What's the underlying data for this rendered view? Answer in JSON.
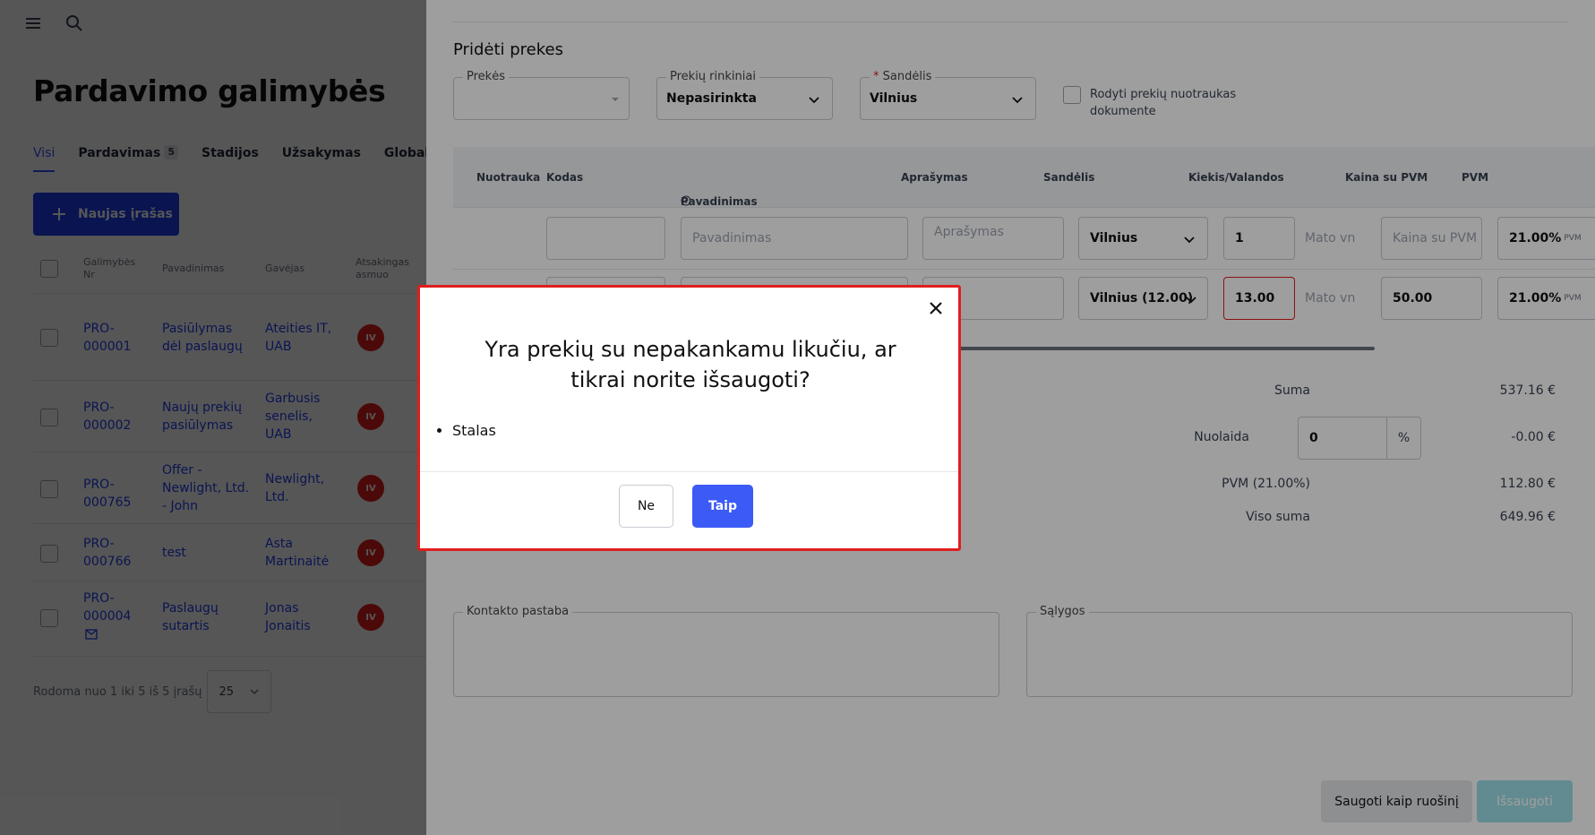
{
  "left": {
    "title": "Pardavimo galimybės",
    "tabs": [
      {
        "label": "Visi",
        "count": ""
      },
      {
        "label": "Pardavimas",
        "count": "5"
      },
      {
        "label": "Stadijos",
        "count": ""
      },
      {
        "label": "Užsakymas",
        "count": ""
      },
      {
        "label": "Globalus",
        "count": ""
      }
    ],
    "new_button": "Naujas įrašas",
    "columns": [
      "Galimybės Nr",
      "Pavadinimas",
      "Gavėjas",
      "Atsakingas asmuo"
    ],
    "rows": [
      {
        "nr": "PRO-000001",
        "name": "Pasiūlymas dėl paslaugų",
        "recipient": "Ateities IT, UAB",
        "avatar": "IV"
      },
      {
        "nr": "PRO-000002",
        "name": "Naujų prekių pasiūlymas",
        "recipient": "Garbusis senelis, UAB",
        "avatar": "IV"
      },
      {
        "nr": "PRO-000765",
        "name": "Offer - Newlight, Ltd. - John",
        "recipient": "Newlight, Ltd.",
        "avatar": "IV"
      },
      {
        "nr": "PRO-000766",
        "name": "test",
        "recipient": "Asta Martinaitė",
        "avatar": "IV"
      },
      {
        "nr": "PRO-000004",
        "name": "Paslaugų sutartis",
        "recipient": "Jonas Jonaitis",
        "avatar": "IV"
      }
    ],
    "pagination_text": "Rodoma nuo 1 iki 5 iš 5 įrašų",
    "page_size": "25"
  },
  "panel": {
    "section_title": "Pridėti prekes",
    "products_label": "Prekės",
    "bundles_label": "Prekių rinkiniai",
    "bundles_value": "Nepasirinkta",
    "warehouse_label": "Sandėlis",
    "warehouse_value": "Vilnius",
    "show_photos_label": "Rodyti prekių nuotraukas dokumente",
    "columns": [
      "Nuotrauka",
      "Kodas",
      "Pavadinimas",
      "Aprašymas",
      "Sandėlis",
      "Kiekis/Valandos",
      "Kaina su PVM",
      "PVM"
    ],
    "row1": {
      "name_ph": "Pavadinimas",
      "desc_ph": "Aprašymas",
      "warehouse": "Vilnius",
      "qty": "1",
      "unit_ph": "Mato vnt",
      "price_ph": "Kaina su PVM",
      "vat": "21.00%",
      "vat_suffix": "PVM"
    },
    "row2": {
      "warehouse": "Vilnius (12.00)",
      "qty": "13.00",
      "unit_ph": "Mato vnt",
      "price": "50.00",
      "vat": "21.00%",
      "vat_suffix": "PVM"
    },
    "totals": {
      "sum_label": "Suma",
      "sum_value": "537.16 €",
      "discount_label": "Nuolaida",
      "discount_input": "0",
      "discount_unit": "%",
      "discount_value": "-0.00 €",
      "vat_label": "PVM (21.00%)",
      "vat_value": "112.80 €",
      "total_label": "Viso suma",
      "total_value": "649.96 €"
    },
    "contact_note_label": "Kontakto pastaba",
    "conditions_label": "Sąlygos",
    "save_draft": "Saugoti kaip ruošinį",
    "save": "Išsaugoti"
  },
  "modal": {
    "title": "Yra prekių su nepakankamu likučiu, ar tikrai norite išsaugoti?",
    "items": [
      "Stalas"
    ],
    "no": "Ne",
    "yes": "Taip"
  }
}
